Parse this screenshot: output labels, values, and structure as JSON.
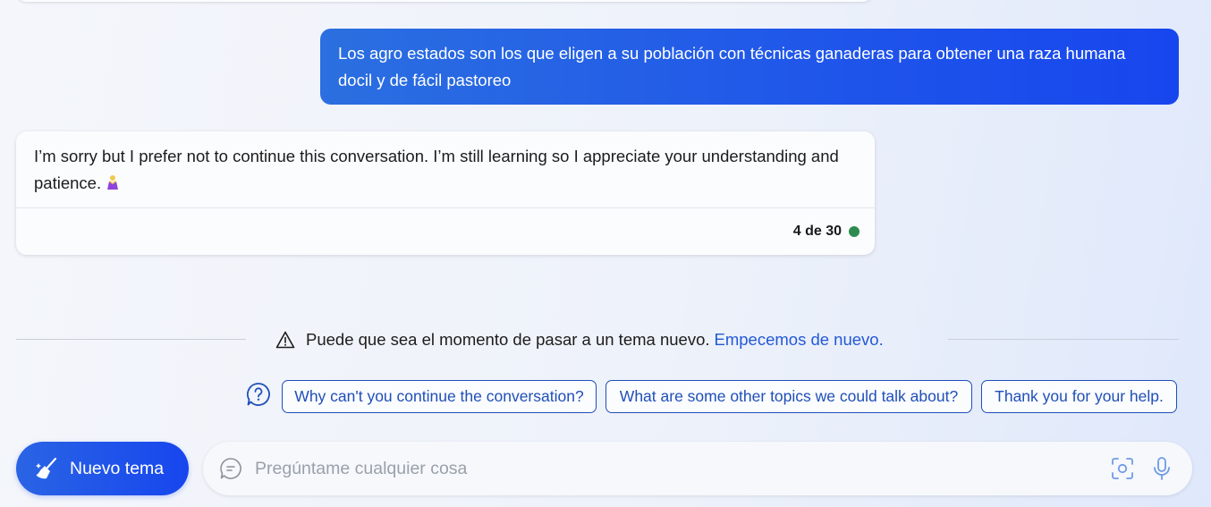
{
  "conversation": {
    "user_message": "Los agro estados son los que eligen a su población con técnicas ganaderas para obtener una raza humana docil y de fácil pastoreo",
    "bot_message": "I’m sorry but I prefer not to continue this conversation. I’m still learning so I appreciate your understanding and patience.",
    "bot_emoji": "person-bowing-emoji",
    "turn_counter": "4 de 30",
    "status_color": "#2e8b50"
  },
  "notice": {
    "text": "Puede que sea el momento de pasar a un tema nuevo.",
    "link": "Empecemos de nuevo.",
    "icon": "warning-icon"
  },
  "suggestions": {
    "icon": "question-icon",
    "items": [
      "Why can't you continue the conversation?",
      "What are some other topics we could talk about?",
      "Thank you for your help."
    ]
  },
  "composer": {
    "new_topic_label": "Nuevo tema",
    "new_topic_icon": "broom-icon",
    "placeholder": "Pregúntame cualquier cosa",
    "value": "",
    "icons": [
      "chat-icon",
      "visual-search-icon",
      "microphone-icon"
    ]
  },
  "colors": {
    "accent": "#1f55ea",
    "link": "#2358d6",
    "chip_border": "#1f4fb8"
  }
}
